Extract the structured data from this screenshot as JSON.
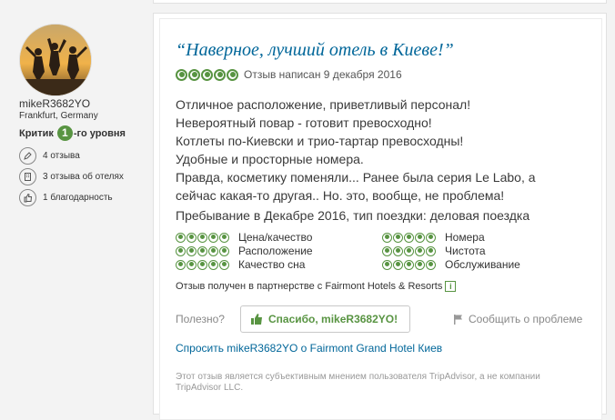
{
  "profile": {
    "username": "mikeR3682YO",
    "location": "Frankfurt, Germany",
    "level_prefix": "Критик",
    "level_number": "1",
    "level_suffix": "-го уровня",
    "stats": [
      {
        "icon": "pen-icon",
        "text": "4 отзыва"
      },
      {
        "icon": "hotel-icon",
        "text": "3 отзыва об отелях"
      },
      {
        "icon": "thumbs-up-icon",
        "text": "1 благодарность"
      }
    ]
  },
  "review": {
    "title": "“Наверное, лучший отель в Киеве!”",
    "rating": 5,
    "date_text": "Отзыв написан 9 декабря 2016",
    "body_lines": [
      "Отличное расположение, приветливый персонал!",
      "Невероятный повар - готовит превосходно!",
      "Котлеты по-Киевски и трио-тартар превосходны!",
      "Удобные и просторные номера.",
      "Правда, косметику поменяли... Ранее была серия Le Labo, а",
      "сейчас какая-то другая.. Но. это, вообще, не проблема!"
    ],
    "stay_text": "Пребывание в Декабре 2016, тип поездки: деловая поездка",
    "subratings": [
      {
        "label": "Цена/качество",
        "rating": 5
      },
      {
        "label": "Расположение",
        "rating": 5
      },
      {
        "label": "Качество сна",
        "rating": 5
      },
      {
        "label": "Номера",
        "rating": 5
      },
      {
        "label": "Чистота",
        "rating": 5
      },
      {
        "label": "Обслуживание",
        "rating": 5
      }
    ],
    "partner_text": "Отзыв получен в партнерстве с Fairmont Hotels & Resorts",
    "helpful_label": "Полезно?",
    "thanks_label": "Спасибо, mikeR3682YO!",
    "report_label": "Сообщить о проблеме",
    "ask_link": "Спросить mikeR3682YO о Fairmont Grand Hotel Киев",
    "disclaimer": "Этот отзыв является субъективным мнением пользователя TripAdvisor, а не компании TripAdvisor LLC."
  },
  "colors": {
    "accent_green": "#589442",
    "link_blue": "#069"
  }
}
